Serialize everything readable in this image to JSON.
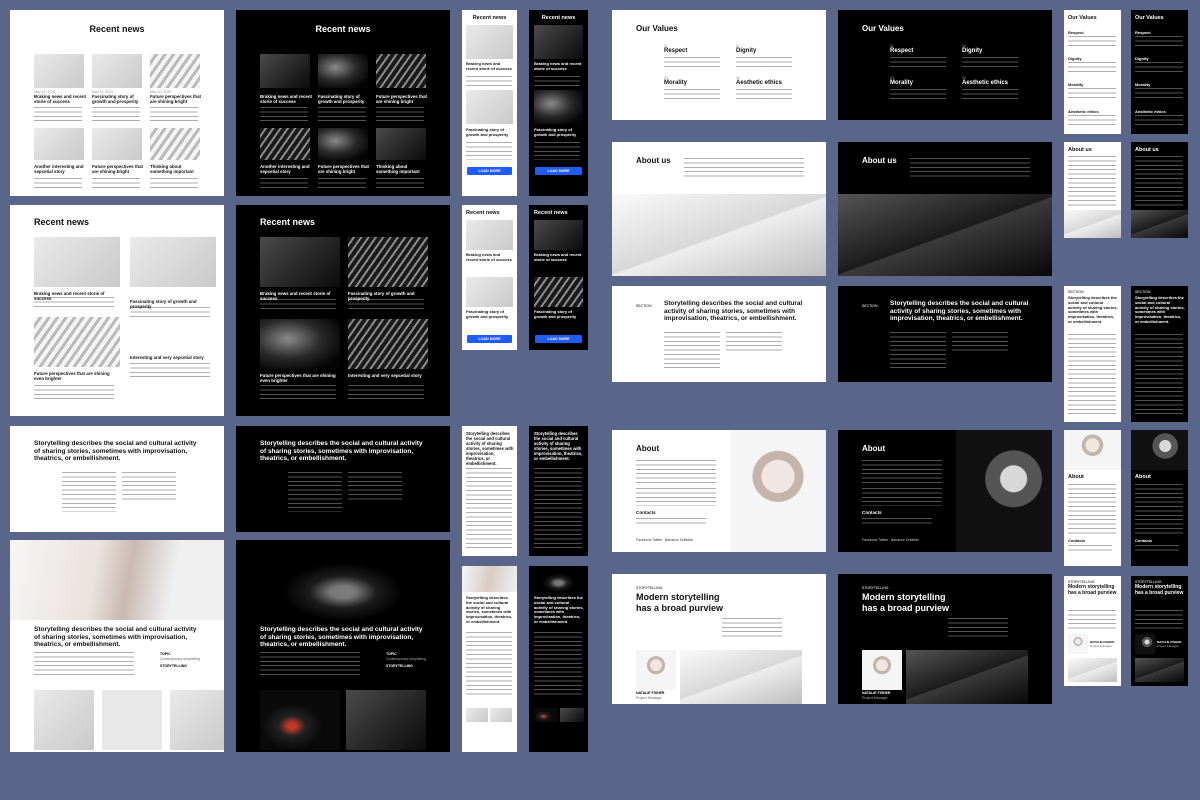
{
  "news": {
    "heading": "Recent news",
    "date": "May 10, 2020",
    "items": [
      "Braking news and recent storie of success",
      "Fascinating story of growth and prosperity",
      "Future perspectives that are shining bright",
      "Another interesting and sepcetial story",
      "Future perspectives that are shining bright",
      "Thinking about something important"
    ],
    "grid2": [
      "Braking news and recent storie of success",
      "Fascinating story of growth and prosperity",
      "Future perspectives that are shining even brighter",
      "Interesting and very sepcetial story"
    ],
    "load_more": "LOAD MORE"
  },
  "values": {
    "heading": "Our Values",
    "items": [
      {
        "num": "01",
        "title": "Respect"
      },
      {
        "num": "02",
        "title": "Dignity"
      },
      {
        "num": "03",
        "title": "Morality"
      },
      {
        "num": "04",
        "title": "Aesthetic ethics"
      }
    ]
  },
  "about_us": {
    "heading": "About us"
  },
  "story": {
    "section": "SECTION",
    "headline": "Storytelling describes the social and cultural activity of sharing stories, sometimes with improvisation, theatrics, or embellishment.",
    "topic_label": "TOPIC",
    "topic_value": "Contemporary storytelling",
    "label2": "STORYTELLING"
  },
  "about": {
    "heading": "About",
    "contacts": "Contacts",
    "social": [
      "Facebook",
      "Twitter",
      "Behance",
      "Dribbble"
    ]
  },
  "modern": {
    "tag": "STORYTELLING",
    "headline": "Modern storytelling has a broad purview",
    "person": "NATALIE FISHER",
    "role": "Project Manager"
  }
}
